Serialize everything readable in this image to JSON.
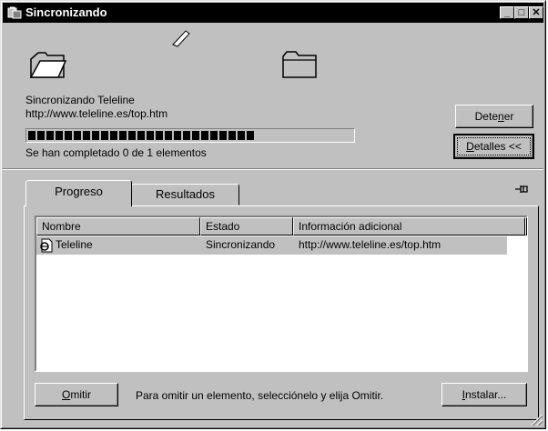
{
  "window": {
    "title": "Sincronizando",
    "minimize": "_",
    "maximize": "□",
    "close": "✕"
  },
  "status": {
    "line1": "Sincronizando Teleline",
    "line2": "http://www.teleline.es/top.htm",
    "completed": "Se han completado 0 de 1 elementos",
    "progress_fraction": 0.72
  },
  "buttons": {
    "stop_pre": "Dete",
    "stop_key": "n",
    "stop_post": "er",
    "details_key": "D",
    "details_post": "etalles <<",
    "skip_key": "O",
    "skip_post": "mitir",
    "install_key": "I",
    "install_post": "nstalar..."
  },
  "tabs": [
    {
      "label": "Progreso"
    },
    {
      "label": "Resultados"
    }
  ],
  "list": {
    "columns": [
      "Nombre",
      "Estado",
      "Información adicional"
    ],
    "rows": [
      {
        "name": "Teleline",
        "status": "Sincronizando",
        "info": "http://www.teleline.es/top.htm"
      }
    ]
  },
  "hint": "Para omitir un elemento, selecciónelo y elija Omitir.",
  "icons": {
    "title": "sync-icon",
    "source": "folder-open-icon",
    "dest": "folder-icon",
    "paper": "paper-flying-icon",
    "row": "web-page-icon",
    "pin": "pushpin-icon"
  }
}
